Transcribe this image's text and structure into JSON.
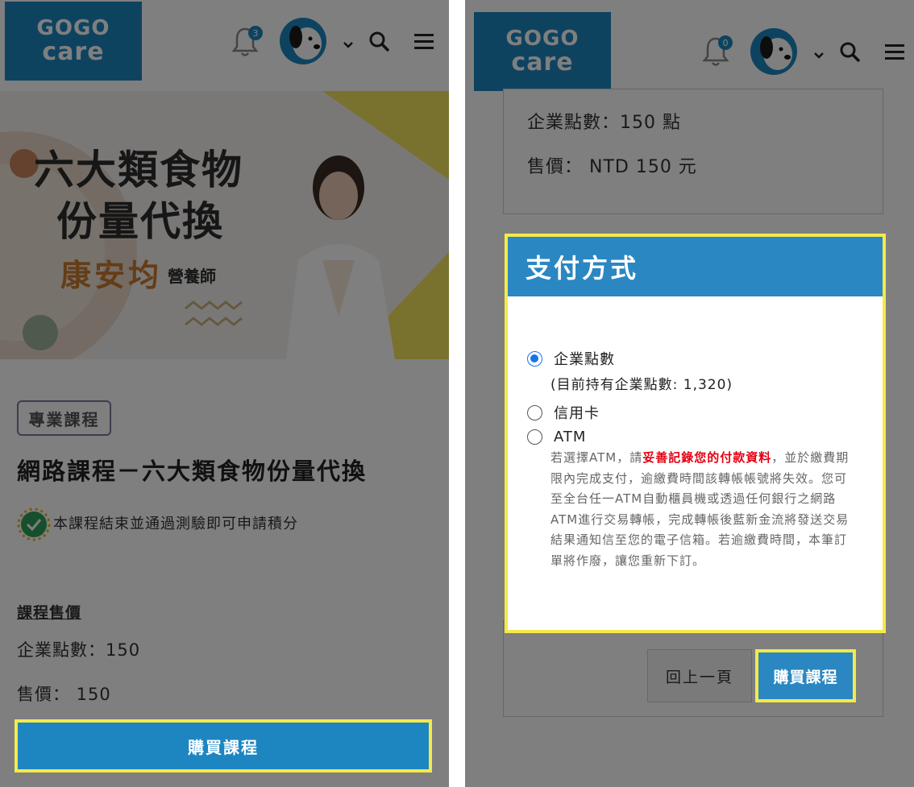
{
  "left": {
    "logo": {
      "line1": "GOGO",
      "line2": "care"
    },
    "notification_count": "3",
    "banner": {
      "title_line1": "六大類食物",
      "title_line2": "份量代換",
      "name": "康安均",
      "role": "營養師"
    },
    "tag": "專業課程",
    "course_title": "網路課程－六大類食物份量代換",
    "credit_note": "本課程結束並通過測驗即可申請積分",
    "price_label": "課程售價",
    "points_line": "企業點數：150",
    "price_line": "售價： 150",
    "buy_button": "購買課程"
  },
  "right": {
    "logo": {
      "line1": "GOGO",
      "line2": "care"
    },
    "notification_count": "0",
    "points_line": "企業點數：150 點",
    "price_line": "售價： NTD 150 元",
    "payment": {
      "header": "支付方式",
      "options": [
        {
          "label": "企業點數",
          "selected": true
        },
        {
          "label": "信用卡",
          "selected": false
        },
        {
          "label": "ATM",
          "selected": false
        }
      ],
      "points_held": "(目前持有企業點數: 1,320)",
      "atm_note_before": "若選擇ATM，請",
      "atm_note_warn": "妥善記錄您的付款資料",
      "atm_note_after": "，並於繳費期限內完成支付，逾繳費時間該轉帳帳號將失效。您可至全台任一ATM自動櫃員機或透過任何銀行之網路ATM進行交易轉帳，完成轉帳後藍新金流將發送交易結果通知信至您的電子信箱。若逾繳費時間，本筆訂單將作廢，讓您重新下訂。"
    },
    "back_button": "回上一頁",
    "buy_button": "購買課程"
  },
  "colors": {
    "brand": "#1d86c1",
    "highlight": "#f5e94a",
    "warn": "#e60012",
    "radio": "#1a73e8"
  }
}
